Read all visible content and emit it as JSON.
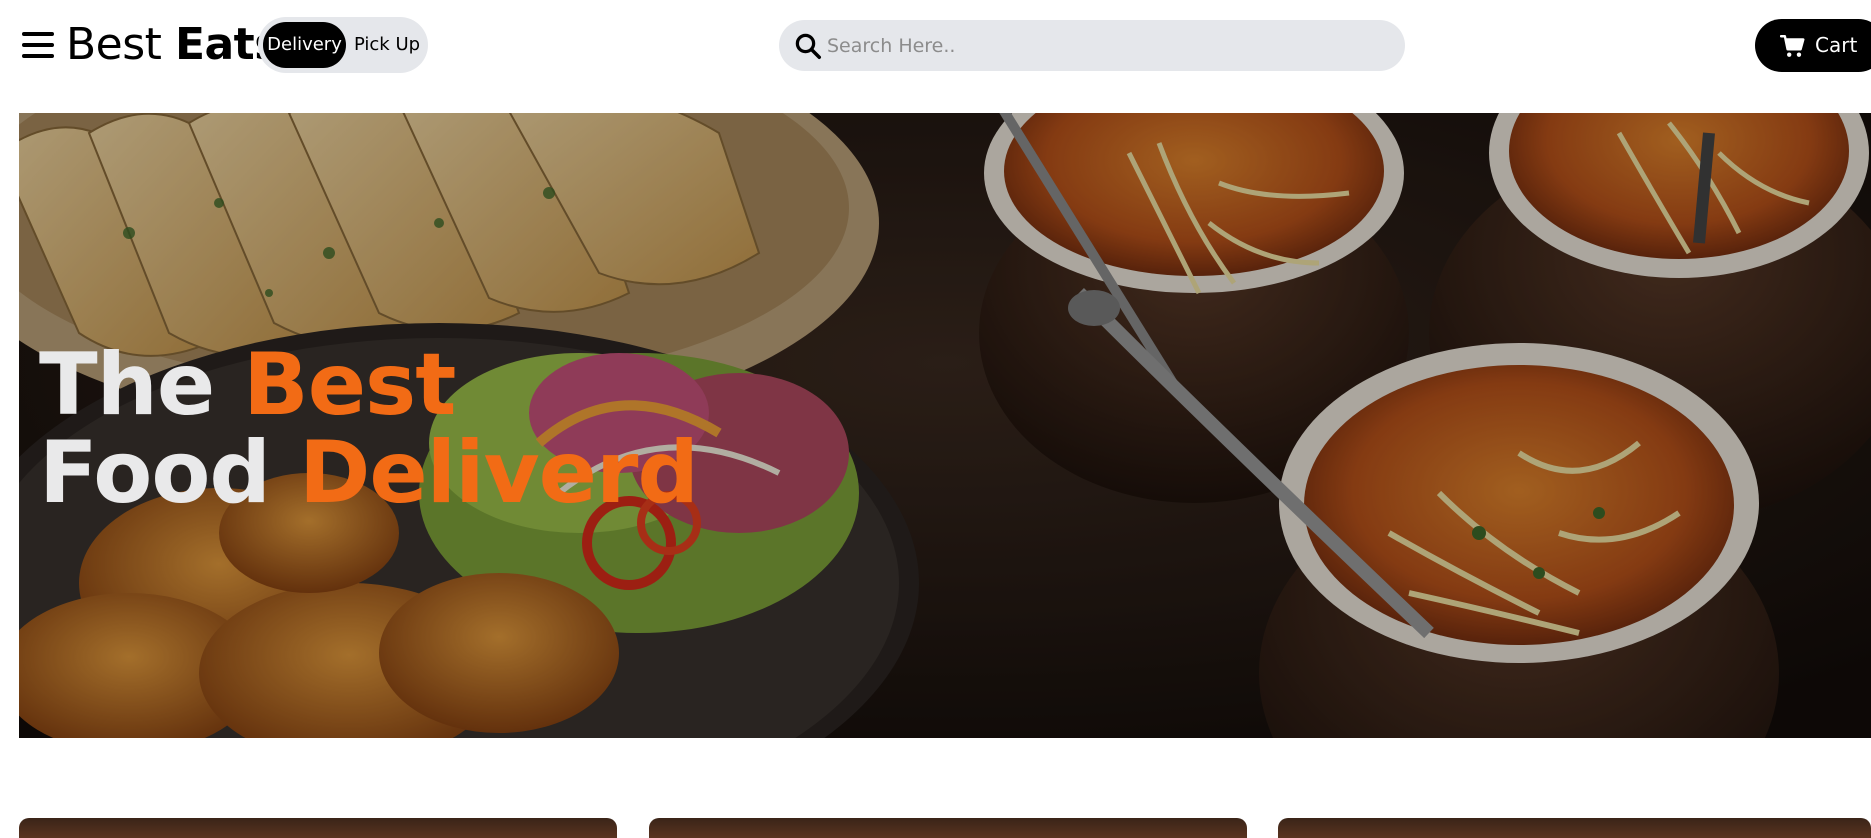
{
  "header": {
    "logo_light": "Best",
    "logo_bold": "Eats",
    "toggle": {
      "delivery_label": "Delivery",
      "pickup_label": "Pick Up",
      "selected": "Delivery"
    },
    "search": {
      "placeholder": "Search Here.."
    },
    "cart_label": "Cart"
  },
  "hero": {
    "line1_plain": "The",
    "line1_accent": "Best",
    "line2_plain": "Food",
    "line2_accent": "Deliverd"
  },
  "icons": {
    "menu": "menu-icon",
    "search": "search-icon",
    "cart": "cart-icon"
  },
  "colors": {
    "accent": "#f26b15",
    "button_dark": "#000000",
    "pill_bg": "#e5e7eb",
    "hero_text": "#e9e9ea"
  }
}
